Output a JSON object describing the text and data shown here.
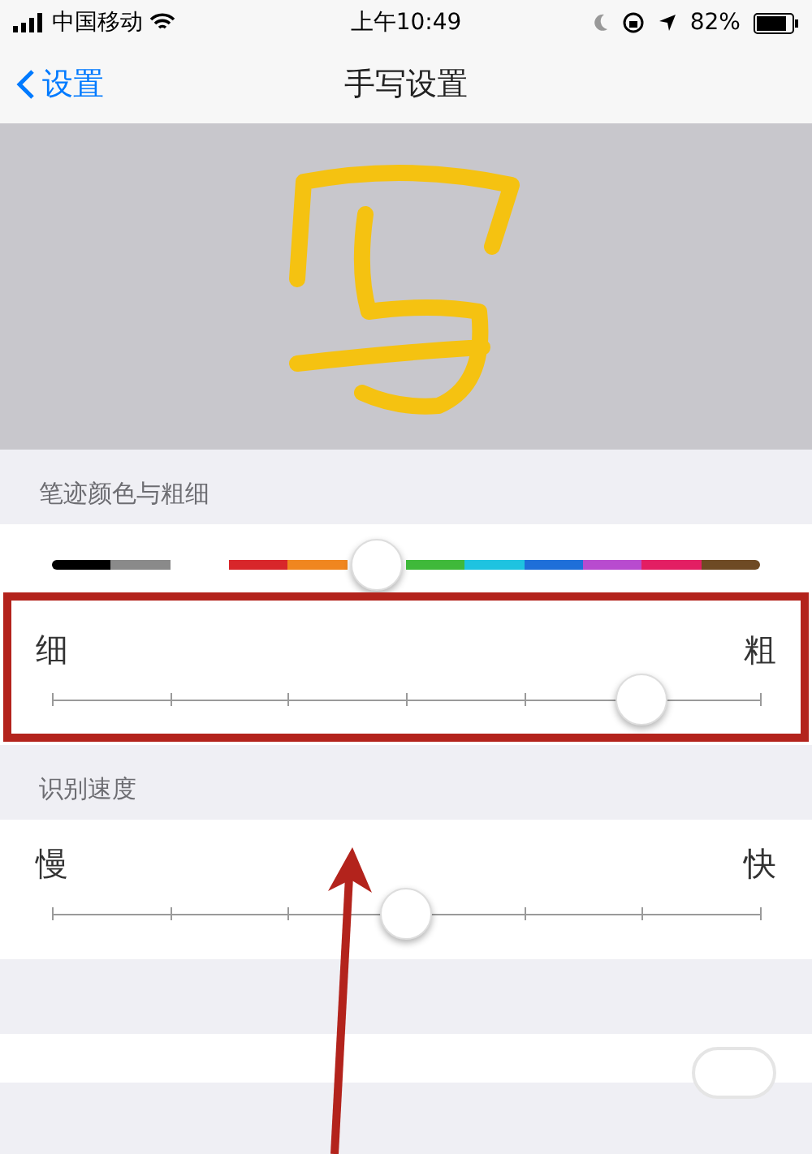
{
  "status_bar": {
    "carrier": "中国移动",
    "time": "上午10:49",
    "battery": "82%"
  },
  "nav": {
    "back": "设置",
    "title": "手写设置"
  },
  "sections": [
    {
      "header": "笔迹颜色与粗细",
      "rows": [
        {
          "kind": "colors",
          "level": 0.46,
          "swatches": [
            {
              "color": "#000000"
            },
            {
              "color": "#8a8a8a"
            },
            {
              "color": "#ffffff"
            },
            {
              "color": "#d8262a"
            },
            {
              "color": "#f0861f"
            },
            {
              "color": "#3fb93a"
            },
            {
              "color": "#1ec3e0"
            },
            {
              "color": "#1e6fd9"
            },
            {
              "color": "#b84bcf"
            },
            {
              "color": "#e31e63"
            },
            {
              "color": "#6e4a24"
            }
          ]
        },
        {
          "kind": "steps",
          "min": "细",
          "max": "粗",
          "level": 0.833,
          "highlighted": true
        }
      ]
    },
    {
      "header": "识别速度",
      "rows": [
        {
          "kind": "steps",
          "min": "慢",
          "max": "快",
          "level": 0.5,
          "highlighted": false
        }
      ]
    },
    {
      "rows": [
        {
          "kind": "toggle",
          "on": false
        }
      ]
    }
  ]
}
